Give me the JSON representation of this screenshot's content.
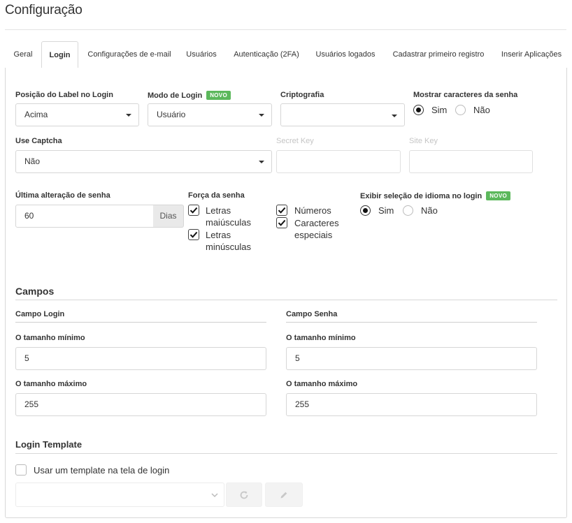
{
  "page": {
    "title": "Configuração"
  },
  "tabs": [
    {
      "label": "Geral"
    },
    {
      "label": "Login"
    },
    {
      "label": "Configurações de e-mail"
    },
    {
      "label": "Usuários"
    },
    {
      "label": "Autenticação (2FA)"
    },
    {
      "label": "Usuários logados"
    },
    {
      "label": "Cadastrar primeiro registro"
    },
    {
      "label": "Inserir Aplicações"
    }
  ],
  "active_tab": "Login",
  "login": {
    "label_position": {
      "label": "Posição do Label no Login",
      "value": "Acima"
    },
    "login_mode": {
      "label": "Modo de Login",
      "badge": "NOVO",
      "value": "Usuário"
    },
    "encryption": {
      "label": "Criptografia",
      "value": ""
    },
    "show_password_chars": {
      "label": "Mostrar caracteres da senha",
      "options": [
        "Sim",
        "Não"
      ],
      "selected": "Sim"
    },
    "use_captcha": {
      "label": "Use Captcha",
      "value": "Não"
    },
    "secret_key": {
      "label": "Secret Key",
      "value": ""
    },
    "site_key": {
      "label": "Site Key",
      "value": ""
    },
    "last_password_change": {
      "label": "Última alteração de senha",
      "value": "60",
      "addon": "Dias"
    },
    "password_strength": {
      "label": "Força da senha",
      "options": [
        {
          "label": "Letras maiúsculas",
          "checked": true
        },
        {
          "label": "Letras minúsculas",
          "checked": true
        },
        {
          "label": "Números",
          "checked": true
        },
        {
          "label": "Caracteres especiais",
          "checked": true
        }
      ]
    },
    "language_selection": {
      "label": "Exibir seleção de idioma no login",
      "badge": "NOVO",
      "options": [
        "Sim",
        "Não"
      ],
      "selected": "Sim"
    }
  },
  "fields_section": {
    "title": "Campos",
    "login_field": {
      "title": "Campo Login",
      "min_label": "O tamanho mínimo",
      "min_value": "5",
      "max_label": "O tamanho máximo",
      "max_value": "255"
    },
    "password_field": {
      "title": "Campo Senha",
      "min_label": "O tamanho mínimo",
      "min_value": "5",
      "max_label": "O tamanho máximo",
      "max_value": "255"
    }
  },
  "template_section": {
    "title": "Login Template",
    "use_template": {
      "label": "Usar um template na tela de login",
      "checked": false
    },
    "template_select": {
      "value": ""
    },
    "refresh_icon": "refresh-icon",
    "edit_icon": "pencil-icon"
  },
  "colors": {
    "badge": "#5cb85c",
    "border": "#d6d6d6",
    "addon_bg": "#e9e9e9"
  }
}
